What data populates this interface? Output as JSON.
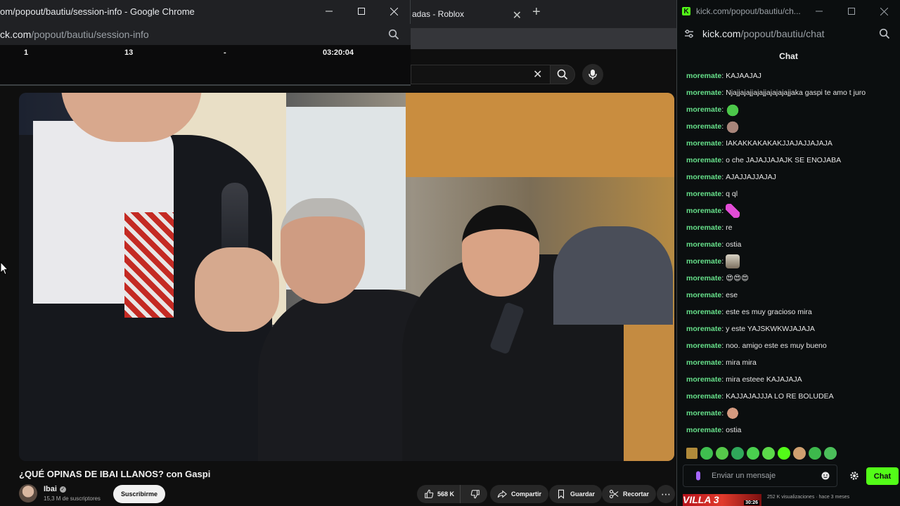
{
  "background_tab": {
    "title": "adas - Roblox",
    "close": "✕",
    "new_tab": "+"
  },
  "video": {
    "title": "¿QUÉ OPINAS DE IBAI LLANOS? con Gaspi",
    "channel": "Ibai",
    "subscribers": "15,3 M de suscriptores",
    "subscribe_label": "Suscribirme",
    "likes": "568 K",
    "share_label": "Compartir",
    "save_label": "Guardar",
    "clip_label": "Recortar",
    "more": "⋯"
  },
  "session_window": {
    "title": "om/popout/bautiu/session-info - Google Chrome",
    "url_host": "ck.com",
    "url_path": "/popout/bautiu/session-info",
    "stats": [
      "1",
      "13",
      "-",
      "03:20:04"
    ]
  },
  "chat_window": {
    "title": "kick.com/popout/bautiu/ch...",
    "logo": "K",
    "url_host": "kick.com",
    "url_path": "/popout/bautiu/chat",
    "header": "Chat",
    "messages": [
      {
        "user": "moremate",
        "text": "KAJAAJAJ"
      },
      {
        "user": "moremate",
        "text": "Njajjajajjajajjajajajajjaka gaspi te amo t juro"
      },
      {
        "user": "moremate",
        "text": "",
        "emote": "frog-emote"
      },
      {
        "user": "moremate",
        "text": "",
        "emote": "cat-emote"
      },
      {
        "user": "moremate",
        "text": "IAKAKKAKAKAKJJAJAJJAJAJA"
      },
      {
        "user": "moremate",
        "text": "o che JAJAJJAJAJK SE ENOJABA"
      },
      {
        "user": "moremate",
        "text": "AJAJJAJJAJAJ"
      },
      {
        "user": "moremate",
        "text": "q ql"
      },
      {
        "user": "moremate",
        "text": "",
        "emote": "pink-emote"
      },
      {
        "user": "moremate",
        "text": "re"
      },
      {
        "user": "moremate",
        "text": "ostia"
      },
      {
        "user": "moremate",
        "text": "",
        "emote": "photo-emote"
      },
      {
        "user": "moremate",
        "text": "😍😍😍"
      },
      {
        "user": "moremate",
        "text": "ese"
      },
      {
        "user": "moremate",
        "text": "este es muy gracioso mira"
      },
      {
        "user": "moremate",
        "text": "y este YAJSKWKWJAJAJA"
      },
      {
        "user": "moremate",
        "text": "noo. amigo este es muy bueno"
      },
      {
        "user": "moremate",
        "text": "mira mira"
      },
      {
        "user": "moremate",
        "text": "mira esteee KAJAJAJA"
      },
      {
        "user": "moremate",
        "text": "KAJJAJAJJJA LO RE BOLUDEA"
      },
      {
        "user": "moremate",
        "text": "",
        "emote": "face-emote"
      },
      {
        "user": "moremate",
        "text": "ostia"
      }
    ],
    "input_placeholder": "Enviar un mensaje",
    "send_label": "Chat"
  },
  "peek": {
    "thumb_text": "VILLA 3",
    "duration": "30:26",
    "meta": "252 K visualizaciones · hace 3 meses"
  },
  "colors": {
    "kick_green": "#53fc18",
    "username": "#66e08a",
    "youtube_bg": "#0f0f0f"
  }
}
